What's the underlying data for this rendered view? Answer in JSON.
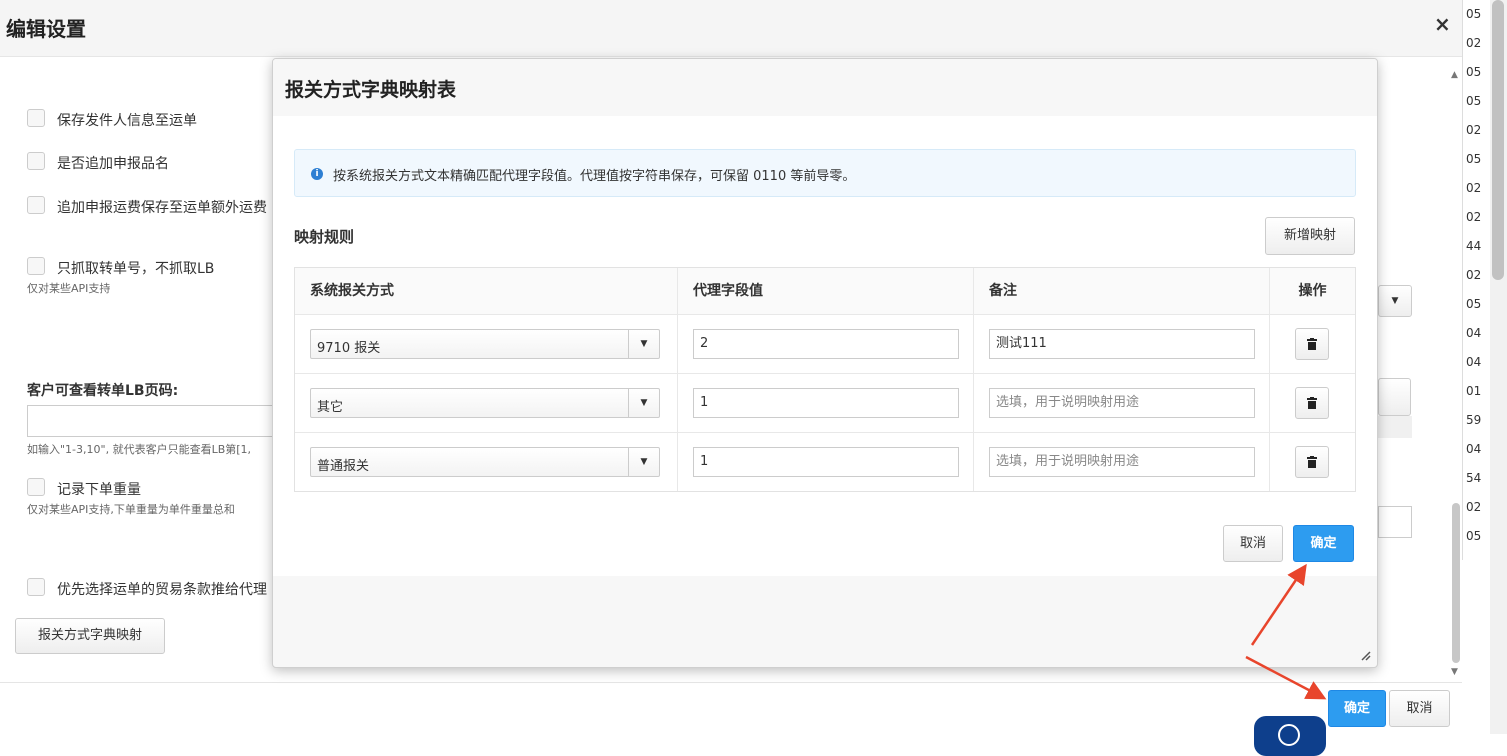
{
  "outer": {
    "title": "编辑设置",
    "close_icon": "×",
    "edge_numbers": [
      "05",
      "02",
      "05",
      "05",
      "02",
      "05",
      "02",
      "02",
      "44",
      "02",
      "05",
      "04",
      "04",
      "01",
      "59",
      "04",
      "54",
      "02",
      "05"
    ],
    "left_form": {
      "save_sender": "保存发件人信息至运单",
      "append_declared_name": "是否追加申报品名",
      "append_freight": "追加申报运费保存至运单额外运费",
      "only_transfer_no": "只抓取转单号，不抓取LB",
      "only_transfer_hint": "仅对某些API支持",
      "lb_page_label": "客户可查看转单LB页码:",
      "lb_page_hint": "如输入\"1-3,10\", 就代表客户只能查看LB第[1,",
      "record_weight": "记录下单重量",
      "record_weight_hint": "仅对某些API支持,下单重量为单件重量总和",
      "prefer_trade_terms": "优先选择运单的贸易条款推给代理",
      "dict_map_button": "报关方式字典映射"
    },
    "footer": {
      "confirm": "确定",
      "cancel": "取消"
    }
  },
  "modal": {
    "title": "报关方式字典映射表",
    "info_icon": "i",
    "info_text": "按系统报关方式文本精确匹配代理字段值。代理值按字符串保存，可保留 0110 等前导零。",
    "rules_title": "映射规则",
    "add_button": "新增映射",
    "table": {
      "headers": [
        "系统报关方式",
        "代理字段值",
        "备注",
        "操作"
      ],
      "rows": [
        {
          "method": "9710 报关",
          "value": "2",
          "note": "测试111"
        },
        {
          "method": "其它",
          "value": "1",
          "note": ""
        },
        {
          "method": "普通报关",
          "value": "1",
          "note": ""
        }
      ],
      "note_placeholder": "选填，用于说明映射用途"
    },
    "cancel": "取消",
    "confirm": "确定"
  },
  "colors": {
    "primary": "#2d9cf0",
    "annotation_arrow": "#e8452c",
    "help_badge": "#0e3f8c"
  }
}
